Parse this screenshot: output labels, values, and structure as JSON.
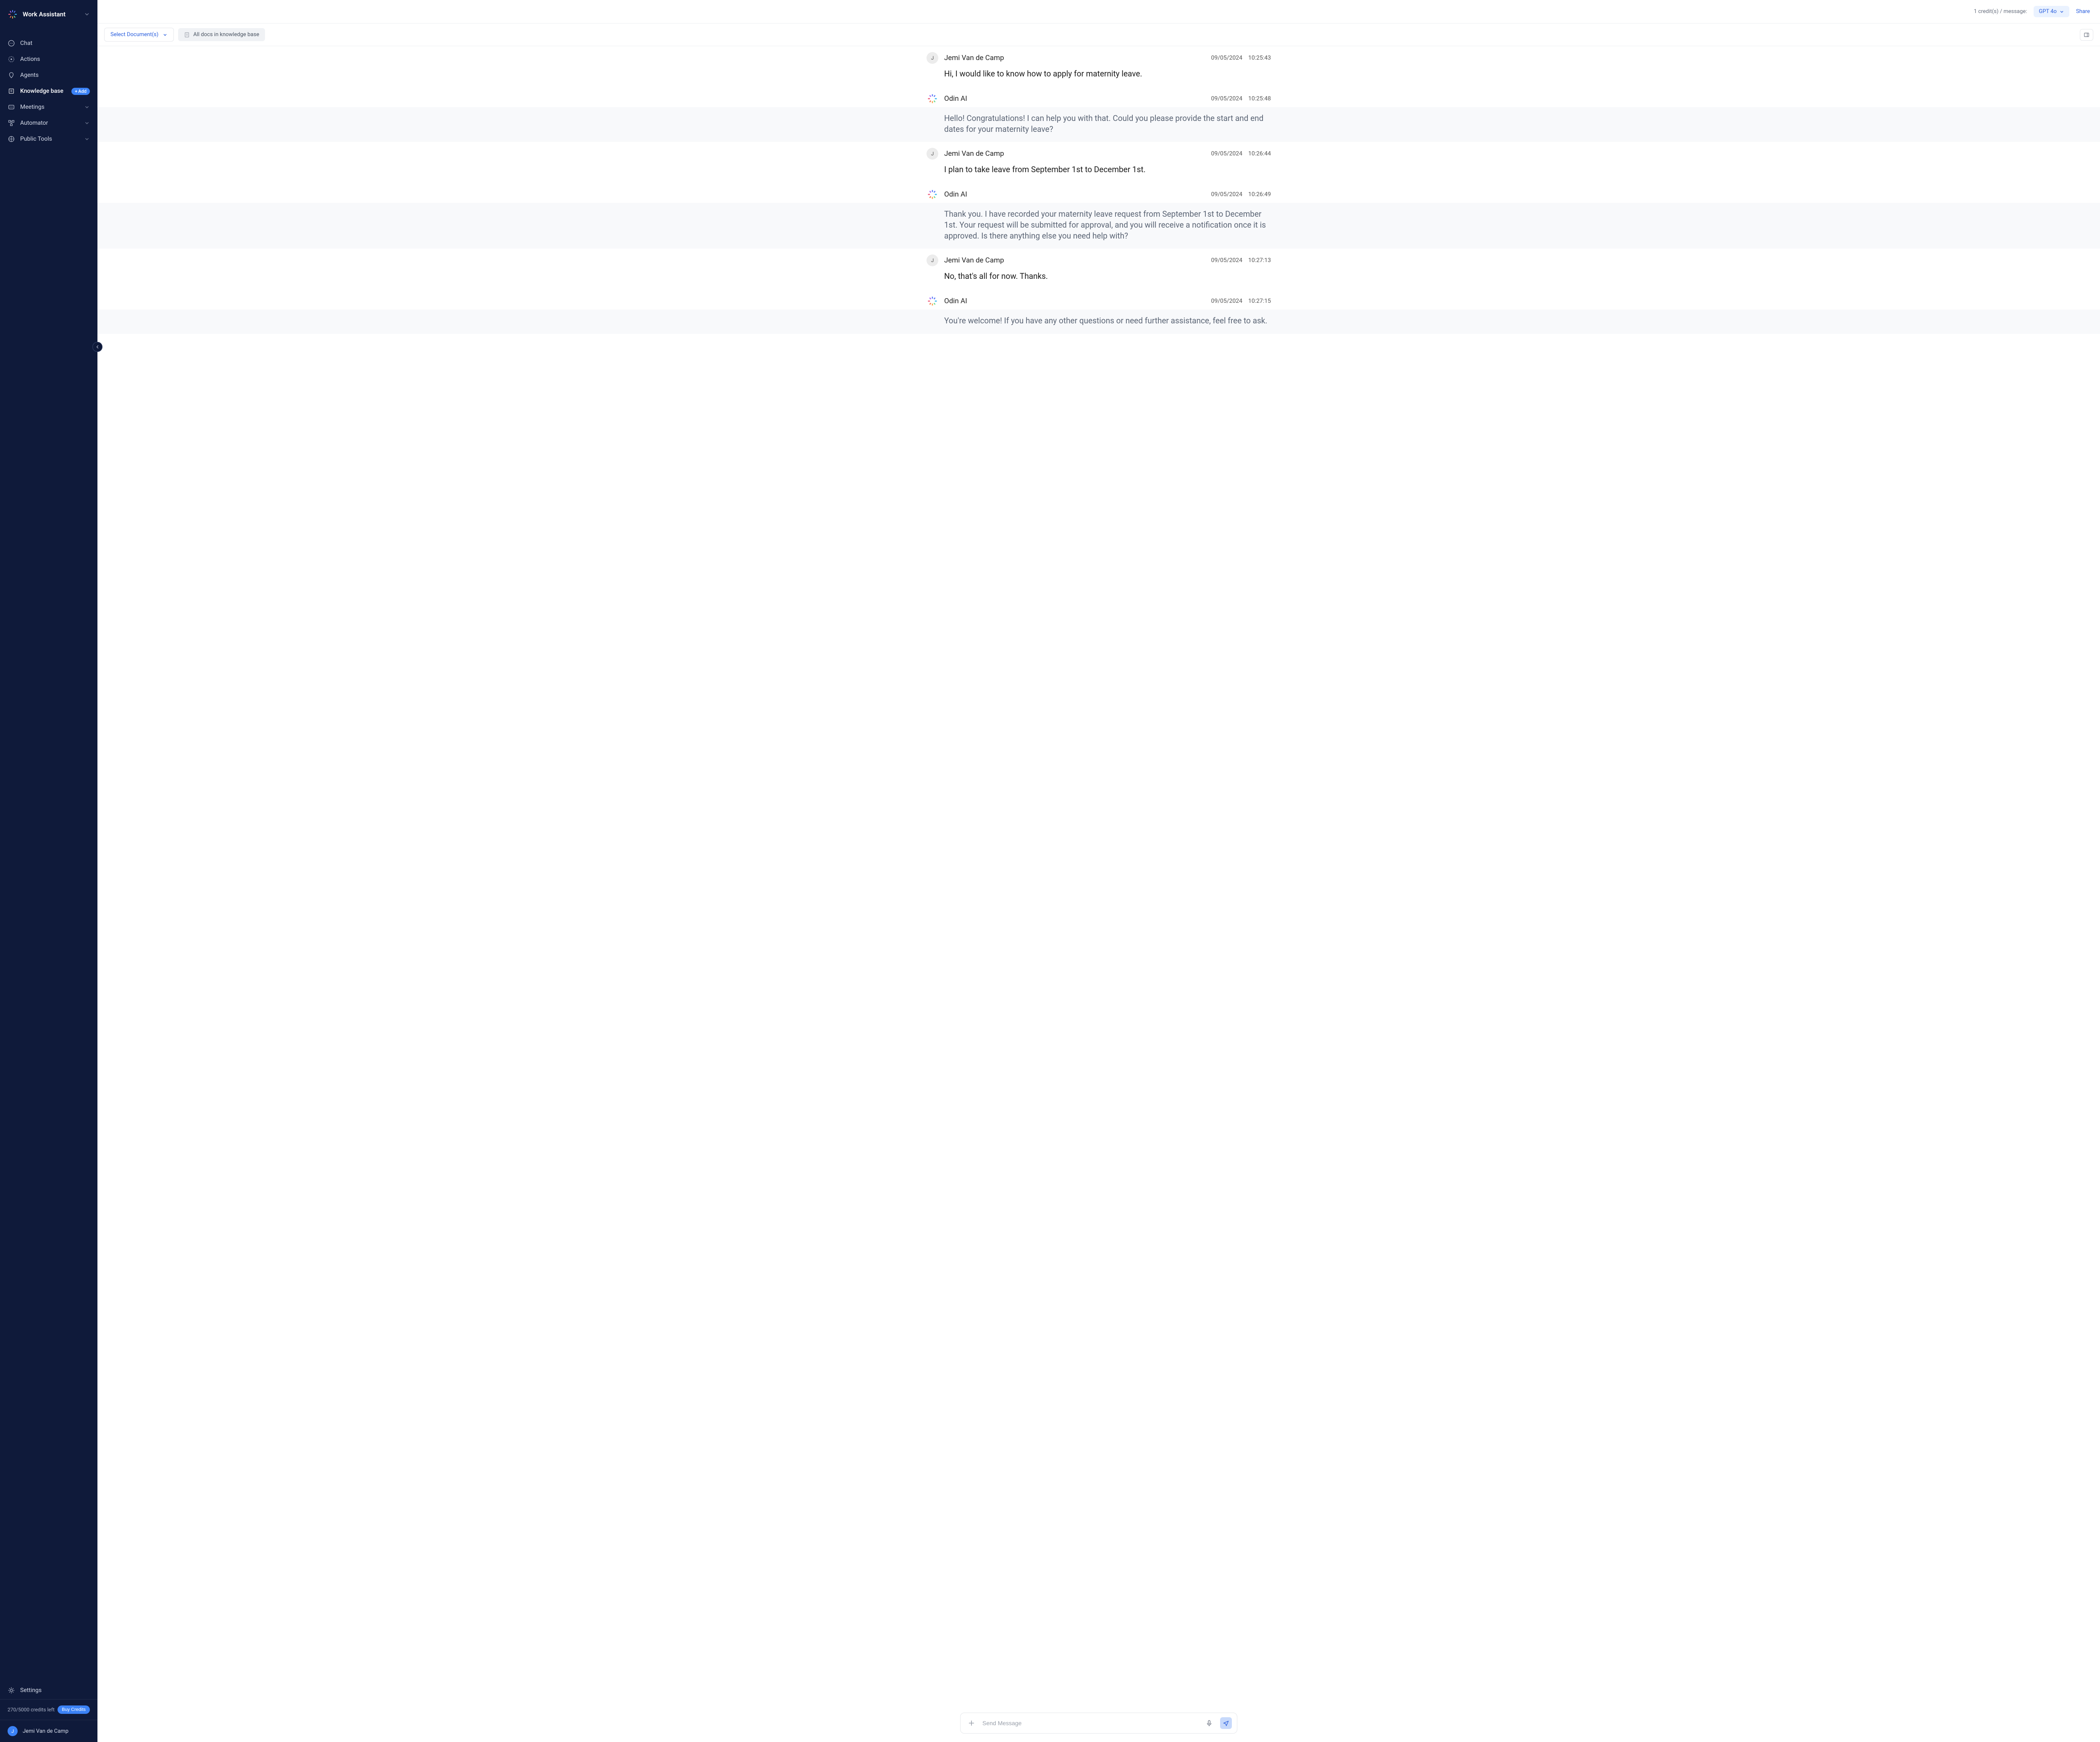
{
  "sidebar": {
    "workspace": "Work Assistant",
    "nav": [
      {
        "label": "Chat"
      },
      {
        "label": "Actions"
      },
      {
        "label": "Agents"
      },
      {
        "label": "Knowledge base",
        "badge": "Add"
      },
      {
        "label": "Meetings",
        "expandable": true
      },
      {
        "label": "Automator",
        "expandable": true
      },
      {
        "label": "Public Tools",
        "expandable": true
      }
    ],
    "settings_label": "Settings",
    "credits_text": "270/5000 credits left",
    "buy_credits_label": "Buy Credits",
    "user_name": "Jemi Van de Camp",
    "user_initial": "J"
  },
  "topbar": {
    "credits_msg": "1 credit(s) / message:",
    "model": "GPT 4o",
    "share": "Share"
  },
  "docbar": {
    "select_label": "Select Document(s)",
    "kb_label": "All docs in knowledge base"
  },
  "messages": [
    {
      "role": "user",
      "name": "Jemi Van de Camp",
      "initial": "J",
      "date": "09/05/2024",
      "time": "10:25:43",
      "text": "Hi, I would like to know how to apply for maternity leave."
    },
    {
      "role": "ai",
      "name": "Odin AI",
      "date": "09/05/2024",
      "time": "10:25:48",
      "text": "Hello! Congratulations! I can help you with that. Could you please provide the start and end dates for your maternity leave?"
    },
    {
      "role": "user",
      "name": "Jemi Van de Camp",
      "initial": "J",
      "date": "09/05/2024",
      "time": "10:26:44",
      "text": "I plan to take leave from September 1st to December 1st."
    },
    {
      "role": "ai",
      "name": "Odin AI",
      "date": "09/05/2024",
      "time": "10:26:49",
      "text": "Thank you. I have recorded your maternity leave request from September 1st to December 1st. Your request will be submitted for approval, and you will receive a notification once it is approved. Is there anything else you need help with?"
    },
    {
      "role": "user",
      "name": "Jemi Van de Camp",
      "initial": "J",
      "date": "09/05/2024",
      "time": "10:27:13",
      "text": "No, that's all for now. Thanks."
    },
    {
      "role": "ai",
      "name": "Odin AI",
      "date": "09/05/2024",
      "time": "10:27:15",
      "text": "You're welcome! If you have any other questions or need further assistance, feel free to ask."
    }
  ],
  "composer": {
    "placeholder": "Send Message"
  }
}
